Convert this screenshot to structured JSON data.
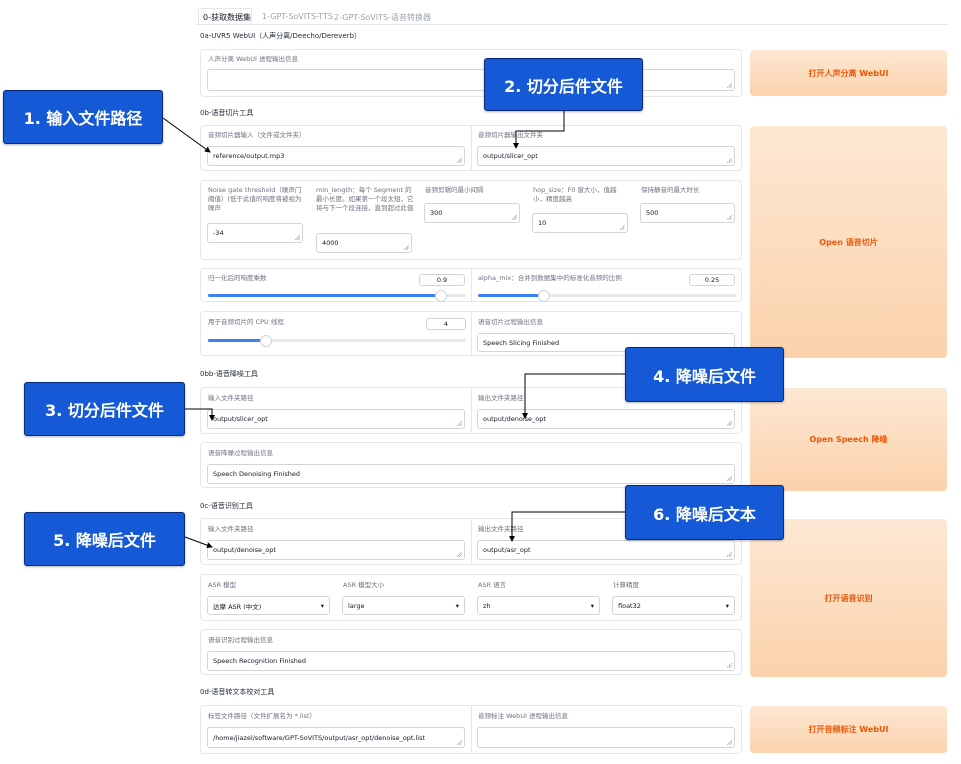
{
  "tabs": [
    "0-获取数据集",
    "1-GPT-SoVITS-TTS",
    "2-GPT-SoVITS-语音转换器"
  ],
  "sections": {
    "uvr": "0a-UVR5 WebUI（人声分离/Deecho/Dereverb）",
    "slicer": "0b-语音切片工具",
    "denoise": "0bb-语音降噪工具",
    "asr": "0c-语音识别工具",
    "proofread": "0d-语音转文本校对工具"
  },
  "uvr": {
    "info_label": "人声分离 WebUI 进程输出信息",
    "button": "打开人声分离 WebUI"
  },
  "slicer": {
    "input_label": "音频切片器输入（文件或文件夹）",
    "input_value": "reference/output.mp3",
    "output_label": "音频切片器输出文件夹",
    "output_value": "output/slicer_opt",
    "threshold_label": "Noise gate threshold（噪声门阈值）(低于此值的响度将被视为噪声",
    "threshold_value": "-34",
    "minlen_label": "min_length：每个 Segment 的最小长度。如果第一个段太短，它将与下一个段连接，直到超过此值",
    "minlen_value": "4000",
    "mininterval_label": "音频剪辑的最小间隔",
    "mininterval_value": "300",
    "hop_label": "hop_size：F0 窗大小，值越小，精度越高",
    "hop_value": "10",
    "maxsil_label": "保持静音的最大时长",
    "maxsil_value": "500",
    "norm_label": "归一化后的响度乘数",
    "norm_value": "0.9",
    "norm_fraction": 0.9,
    "alpha_label": "alpha_mix：合并到数据集中的标准化音频的比例",
    "alpha_value": "0.25",
    "alpha_fraction": 0.25,
    "cpu_label": "用于音频切片的 CPU 线程",
    "cpu_value": "4",
    "cpu_fraction": 0.22,
    "info_label": "语音切片过程输出信息",
    "info_value": "Speech Slicing Finished",
    "button": "Open 语音切片"
  },
  "denoise": {
    "input_label": "输入文件夹路径",
    "input_value": "output/slicer_opt",
    "output_label": "输出文件夹路径",
    "output_value": "output/denoise_opt",
    "info_label": "语音降噪过程输出信息",
    "info_value": "Speech Denoising Finished",
    "button": "Open Speech 降噪"
  },
  "asr": {
    "input_label": "输入文件夹路径",
    "input_value": "output/denoise_opt",
    "output_label": "输出文件夹路径",
    "output_value": "output/asr_opt",
    "model_label": "ASR 模型",
    "model_value": "达摩 ASR (中文)",
    "size_label": "ASR 模型大小",
    "size_value": "large",
    "lang_label": "ASR 语言",
    "lang_value": "zh",
    "precision_label": "计算精度",
    "precision_value": "float32",
    "info_label": "语音识别过程输出信息",
    "info_value": "Speech Recognition Finished",
    "button": "打开语音识别"
  },
  "proofread": {
    "path_label": "标签文件路径（文件扩展名为 *.list）",
    "path_value": "/home/jiazel/software/GPT-SoVITS/output/asr_opt/denoise_opt.list",
    "info_label": "音频标注 WebUI 进程输出信息",
    "button": "打开音频标注 WebUI"
  },
  "callouts": {
    "c1": "1. 输入文件路径",
    "c2": "2. 切分后件文件",
    "c3": "3. 切分后件文件",
    "c4": "4. 降噪后文件",
    "c5": "5. 降噪后文件",
    "c6": "6. 降噪后文本"
  },
  "colors": {
    "accent": "#3b82f6",
    "button_text": "#ea580c",
    "callout_bg": "#1559d6"
  }
}
